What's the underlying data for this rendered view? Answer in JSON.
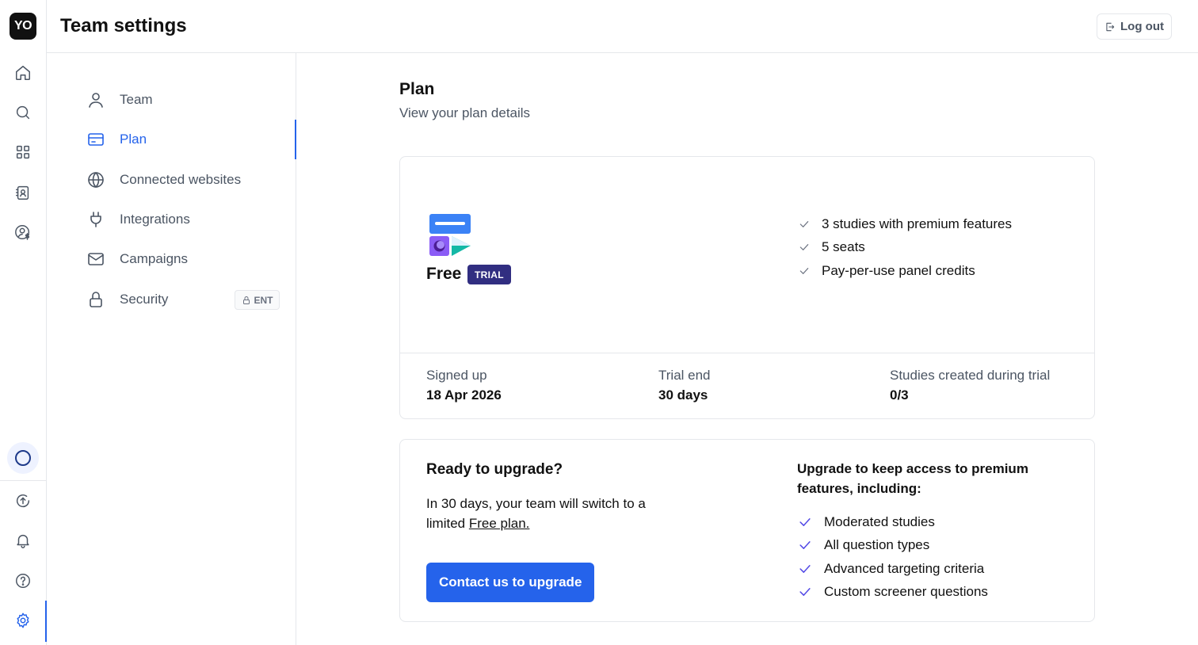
{
  "app": {
    "logo_text": "YO"
  },
  "header": {
    "title": "Team settings",
    "logout_label": "Log out"
  },
  "rail": {
    "items": [
      {
        "icon": "home-icon"
      },
      {
        "icon": "search-icon"
      },
      {
        "icon": "grid-icon"
      },
      {
        "icon": "contacts-icon"
      },
      {
        "icon": "user-billing-icon"
      },
      {
        "icon": "status-circle-icon"
      },
      {
        "icon": "upload-icon"
      },
      {
        "icon": "bell-icon"
      },
      {
        "icon": "help-icon"
      },
      {
        "icon": "gear-icon",
        "active": true
      }
    ]
  },
  "settings_nav": {
    "items": [
      {
        "label": "Team",
        "icon": "user-icon"
      },
      {
        "label": "Plan",
        "icon": "credit-card-icon",
        "active": true
      },
      {
        "label": "Connected websites",
        "icon": "globe-icon"
      },
      {
        "label": "Integrations",
        "icon": "plug-icon"
      },
      {
        "label": "Campaigns",
        "icon": "mail-icon"
      },
      {
        "label": "Security",
        "icon": "lock-icon",
        "badge": "ENT"
      }
    ]
  },
  "main": {
    "title": "Plan",
    "subtitle": "View your plan details"
  },
  "plan_card": {
    "plan_name": "Free",
    "badge": "TRIAL",
    "features": [
      "3 studies with premium features",
      "5 seats",
      "Pay-per-use panel credits"
    ],
    "stats": [
      {
        "label": "Signed up",
        "value": "18 Apr 2026"
      },
      {
        "label": "Trial end",
        "value": "30 days"
      },
      {
        "label": "Studies created during trial",
        "value": "0/3"
      }
    ]
  },
  "upgrade_card": {
    "title": "Ready to upgrade?",
    "text_before": "In 30 days, your team will switch to a limited ",
    "link_text": "Free plan.",
    "button_label": "Contact us to upgrade",
    "right_title": "Upgrade to keep access to premium features, including:",
    "features": [
      "Moderated studies",
      "All question types",
      "Advanced targeting criteria",
      "Custom screener questions"
    ]
  },
  "colors": {
    "accent": "#2563eb",
    "badge_bg": "#312e81",
    "border": "#e5e7eb"
  }
}
